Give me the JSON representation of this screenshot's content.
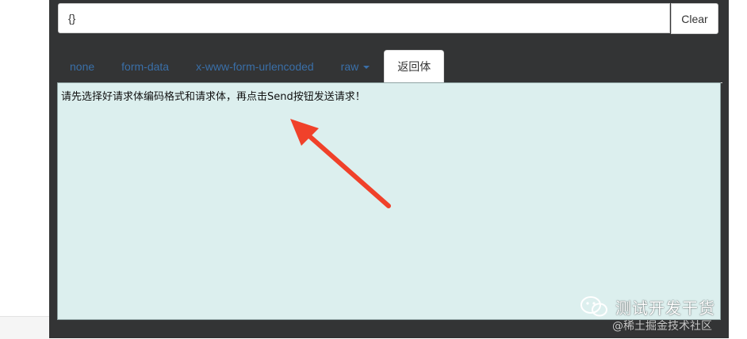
{
  "request_body": {
    "value": "{}",
    "clear_label": "Clear"
  },
  "tabs": [
    {
      "label": "none",
      "active": false
    },
    {
      "label": "form-data",
      "active": false
    },
    {
      "label": "x-www-form-urlencoded",
      "active": false
    },
    {
      "label": "raw",
      "active": false,
      "has_dropdown": true
    },
    {
      "label": "返回体",
      "active": true
    }
  ],
  "response": {
    "message": "请先选择好请求体编码格式和请求体，再点击Send按钮发送请求！"
  },
  "watermark": {
    "title": "测试开发干货",
    "subtitle": "@稀土掘金技术社区"
  },
  "colors": {
    "panel_background": "#333435",
    "response_background": "#dcefee",
    "tab_link": "#3a6fa8",
    "annotation_arrow": "#f0412a"
  },
  "icons": {
    "annotation": "arrow-pointing-up-left",
    "watermark": "wechat-icon"
  }
}
